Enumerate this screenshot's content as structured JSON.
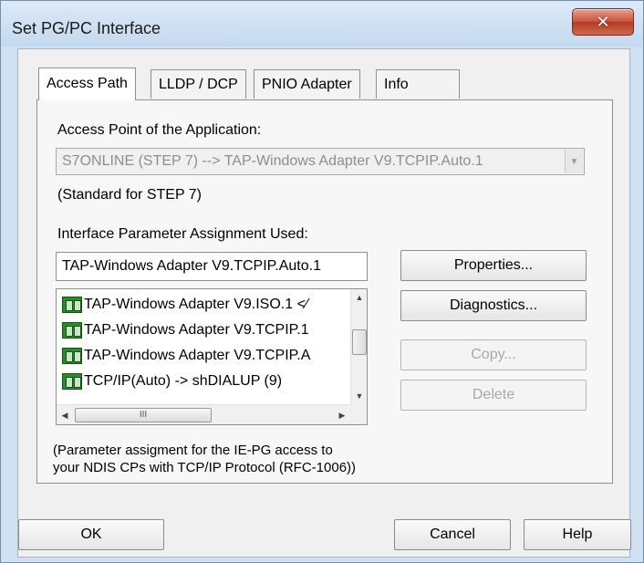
{
  "window": {
    "title": "Set PG/PC Interface",
    "close_glyph": "✕",
    "close_icon": "close-icon"
  },
  "tabs": [
    {
      "label": "Access Path",
      "active": true
    },
    {
      "label": "LLDP / DCP",
      "active": false
    },
    {
      "label": "PNIO Adapter",
      "active": false
    },
    {
      "label": "Info",
      "active": false
    }
  ],
  "access_path": {
    "access_point_label": "Access Point of the Application:",
    "access_point_value": "S7ONLINE (STEP 7)     --> TAP-Windows Adapter V9.TCPIP.Auto.1",
    "access_point_dropdown_glyph": "▼",
    "standard_note": "(Standard for STEP 7)",
    "param_assignment_label": "Interface Parameter Assignment Used:",
    "param_assignment_value": "TAP-Windows Adapter V9.TCPIP.Auto.1",
    "list_items": [
      "TAP-Windows Adapter V9.ISO.1  <⁄",
      "TAP-Windows Adapter V9.TCPIP.1",
      "TAP-Windows Adapter V9.TCPIP.A",
      "TCP/IP(Auto) -> shDIALUP (9)"
    ],
    "list_item_icon": "network-adapter-icon",
    "scroll_up_glyph": "▲",
    "scroll_down_glyph": "▼",
    "scroll_left_glyph": "◀",
    "scroll_right_glyph": "▶",
    "hscroll_thumb_grip": "III",
    "buttons": {
      "properties": "Properties...",
      "diagnostics": "Diagnostics...",
      "copy": "Copy...",
      "delete": "Delete"
    },
    "description": "(Parameter assigment for the IE-PG access to your NDIS CPs with TCP/IP Protocol (RFC-1006))"
  },
  "footer": {
    "ok": "OK",
    "cancel": "Cancel",
    "help": "Help"
  },
  "colors": {
    "close_button": "#c8503a",
    "disabled_text": "#a8a8a8"
  }
}
